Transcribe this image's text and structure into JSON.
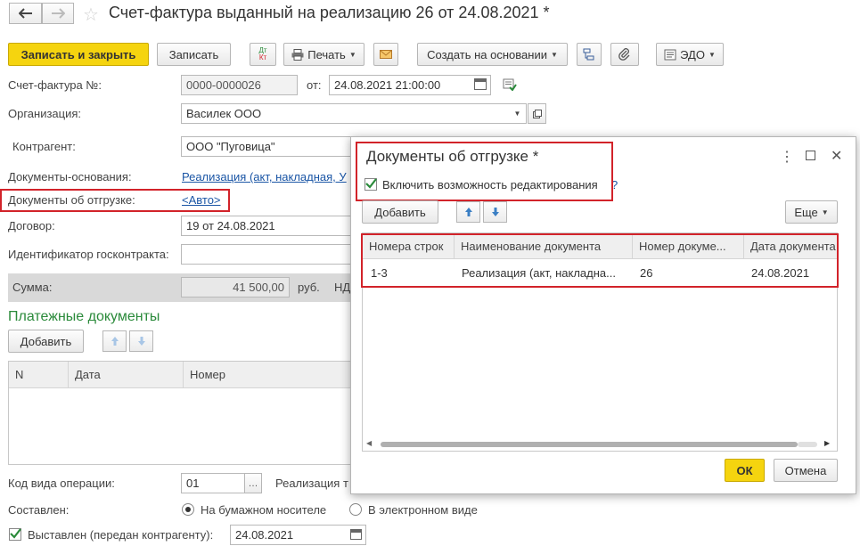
{
  "header": {
    "title": "Счет-фактура выданный на реализацию 26 от 24.08.2021 *"
  },
  "toolbar": {
    "save_close": "Записать и закрыть",
    "save": "Записать",
    "dtkt_top": "Дт",
    "dtkt_bottom": "Кт",
    "print": "Печать",
    "create_based": "Создать на основании",
    "edo": "ЭДО"
  },
  "form": {
    "invoice_no_label": "Счет-фактура №:",
    "invoice_no": "0000-0000026",
    "from_label": "от:",
    "date": "24.08.2021 21:00:00",
    "org_label": "Организация:",
    "org": "Василек ООО",
    "contractor_label": "Контрагент:",
    "contractor": "ООО \"Пуговица\"",
    "base_docs_label": "Документы-основания:",
    "base_docs": "Реализация (акт, накладная, У",
    "shipment_docs_label": "Документы об отгрузке:",
    "shipment_docs": "<Авто>",
    "contract_label": "Договор:",
    "contract": "19 от 24.08.2021",
    "gov_contract_label": "Идентификатор госконтракта:",
    "sum_label": "Сумма:",
    "sum": "41 500,00",
    "currency": "руб.",
    "vat_label": "НД",
    "payments_title": "Платежные документы",
    "add": "Добавить",
    "payments_columns": [
      "N",
      "Дата",
      "Номер"
    ],
    "op_code_label": "Код вида операции:",
    "op_code": "01",
    "op_code_desc": "Реализация т",
    "composed_label": "Составлен:",
    "paper": "На бумажном носителе",
    "electronic": "В электронном виде",
    "issued_label": "Выставлен (передан контрагенту):",
    "issued_date": "24.08.2021"
  },
  "dialog": {
    "title": "Документы об отгрузке *",
    "enable_edit": "Включить возможность редактирования",
    "help": "?",
    "add": "Добавить",
    "more": "Еще",
    "columns": [
      "Номера строк",
      "Наименование документа",
      "Номер докуме...",
      "Дата документа"
    ],
    "row": {
      "lines": "1-3",
      "name": "Реализация (акт, накладна...",
      "number": "26",
      "date": "24.08.2021"
    },
    "ok": "ОК",
    "cancel": "Отмена"
  },
  "colors": {
    "accent_yellow": "#f5d40f",
    "link_blue": "#1a55a5",
    "section_green": "#2a8a3a",
    "highlight_red": "#d2232a"
  }
}
